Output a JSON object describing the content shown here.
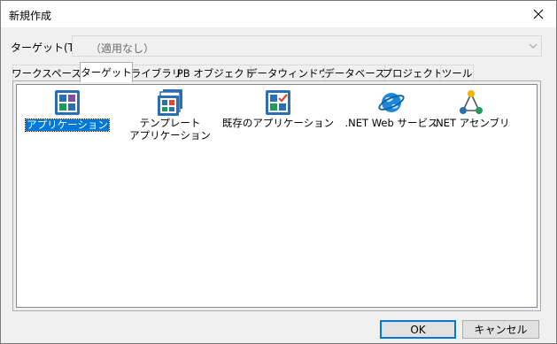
{
  "window": {
    "title": "新規作成"
  },
  "target": {
    "label": "ターゲット(T):",
    "value": "（適用なし）"
  },
  "tabs": [
    {
      "label": "ワークスペース",
      "active": false
    },
    {
      "label": "ターゲット",
      "active": true
    },
    {
      "label": "ライブラリ",
      "active": false
    },
    {
      "label": "PB オブジェクト",
      "active": false
    },
    {
      "label": "データウィンドウ",
      "active": false
    },
    {
      "label": "データベース",
      "active": false
    },
    {
      "label": "プロジェクト",
      "active": false
    },
    {
      "label": "ツール",
      "active": false
    }
  ],
  "items": [
    {
      "label": "アプリケーション",
      "icon": "application-icon",
      "selected": true
    },
    {
      "label": "テンプレート\nアプリケーション",
      "icon": "template-application-icon",
      "selected": false
    },
    {
      "label": "既存のアプリケーション",
      "icon": "existing-application-icon",
      "selected": false
    },
    {
      "label": ".NET Web サービス",
      "icon": "net-web-service-icon",
      "selected": false
    },
    {
      "label": ".NET アセンブリ",
      "icon": "net-assembly-icon",
      "selected": false
    }
  ],
  "buttons": {
    "ok": "OK",
    "cancel": "キャンセル"
  },
  "colors": {
    "accent": "#0078d7",
    "panel_border": "#adadad"
  }
}
